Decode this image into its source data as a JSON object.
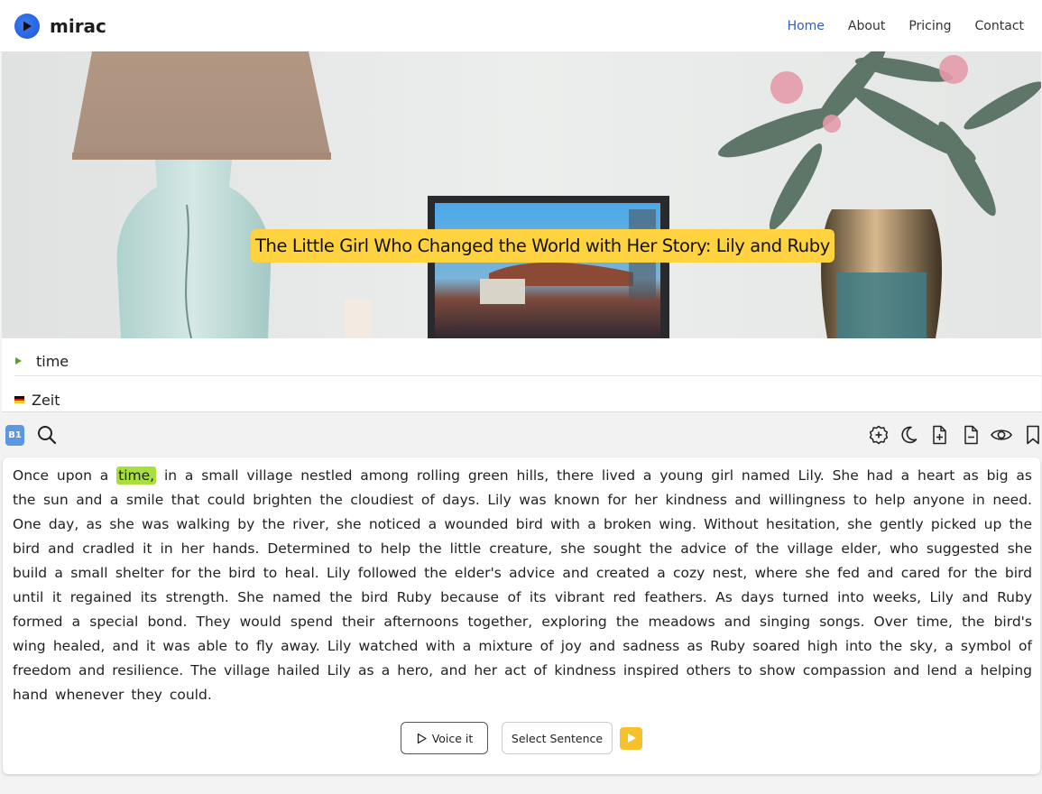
{
  "brand": {
    "name": "mirac",
    "logo_icon": "play-circle-icon",
    "accent": "#2f6ae6"
  },
  "nav": [
    {
      "label": "Home",
      "active": true
    },
    {
      "label": "About",
      "active": false
    },
    {
      "label": "Pricing",
      "active": false
    },
    {
      "label": "Contact",
      "active": false
    }
  ],
  "hero": {
    "title": "The Little Girl Who Changed the World with Her Story: Lily and Ruby",
    "title_bg": "#ffd23f"
  },
  "word": {
    "selected": "time",
    "translation": "Zeit",
    "translation_flag": "german-flag-icon"
  },
  "toolbar": {
    "level": "B1",
    "left_icons": [
      "search-icon"
    ],
    "right_icons": [
      "add-circle-icon",
      "dark-mode-icon",
      "font-increase-icon",
      "font-decrease-icon",
      "visibility-icon",
      "bookmark-icon"
    ]
  },
  "story": {
    "before": "Once upon a",
    "highlight": "time,",
    "after": "in a small village nestled among rolling green hills, there lived a young girl named Lily. She had a heart as big as the sun and a smile that could brighten the cloudiest of days. Lily was known for her kindness and willingness to help anyone in need. One day, as she was walking by the river, she noticed a wounded bird with a broken wing. Without hesitation, she gently picked up the bird and cradled it in her hands. Determined to help the little creature, she sought the advice of the village elder, who suggested she build a small shelter for the bird to heal. Lily followed the elder's advice and created a cozy nest, where she fed and cared for the bird until it regained its strength. She named the bird Ruby because of its vibrant red feathers. As days turned into weeks, Lily and Ruby formed a special bond. They would spend their afternoons together, exploring the meadows and singing songs. Over time, the bird's wing healed, and it was able to fly away. Lily watched with a mixture of joy and sadness as Ruby soared high into the sky, a symbol of freedom and resilience. The village hailed Lily as a hero, and her act of kindness inspired others to show compassion and lend a helping hand whenever they could.",
    "highlight_color": "#a7e03c"
  },
  "actions": {
    "voice_label": "Voice it",
    "select_label": "Select Sentence",
    "play_color": "#f7c12b"
  }
}
